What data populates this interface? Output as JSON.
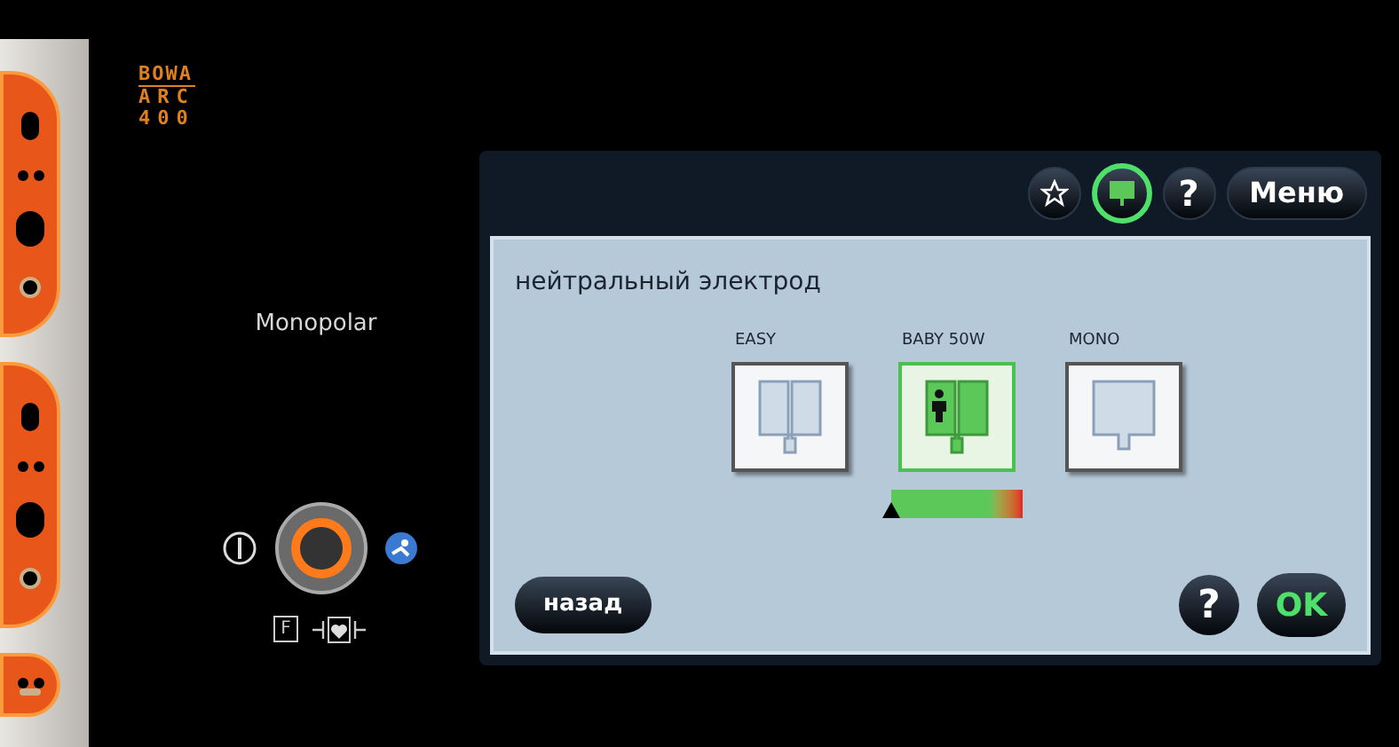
{
  "device": {
    "logo": {
      "brand": "BOWA",
      "line_1": "ARC",
      "line_2": "400"
    },
    "mode_label": "Monopolar",
    "symbol_label": "F"
  },
  "screen": {
    "toolbar": [
      {
        "kind": "star",
        "selected": false
      },
      {
        "kind": "pad",
        "selected": true
      },
      {
        "kind": "help",
        "label": "?",
        "selected": false
      },
      {
        "kind": "menu",
        "label": "Меню",
        "selected": false
      }
    ],
    "title": "нейтральный электрод",
    "electrodes": [
      {
        "label": "EASY",
        "kind": "split",
        "selected": false
      },
      {
        "label": "BABY 50W",
        "kind": "baby",
        "selected": true
      },
      {
        "label": "MONO",
        "kind": "single",
        "selected": false
      }
    ],
    "contact_meter": {
      "level": 0
    },
    "back_button": "назад",
    "help_button": "?",
    "ok_button": "OK"
  }
}
